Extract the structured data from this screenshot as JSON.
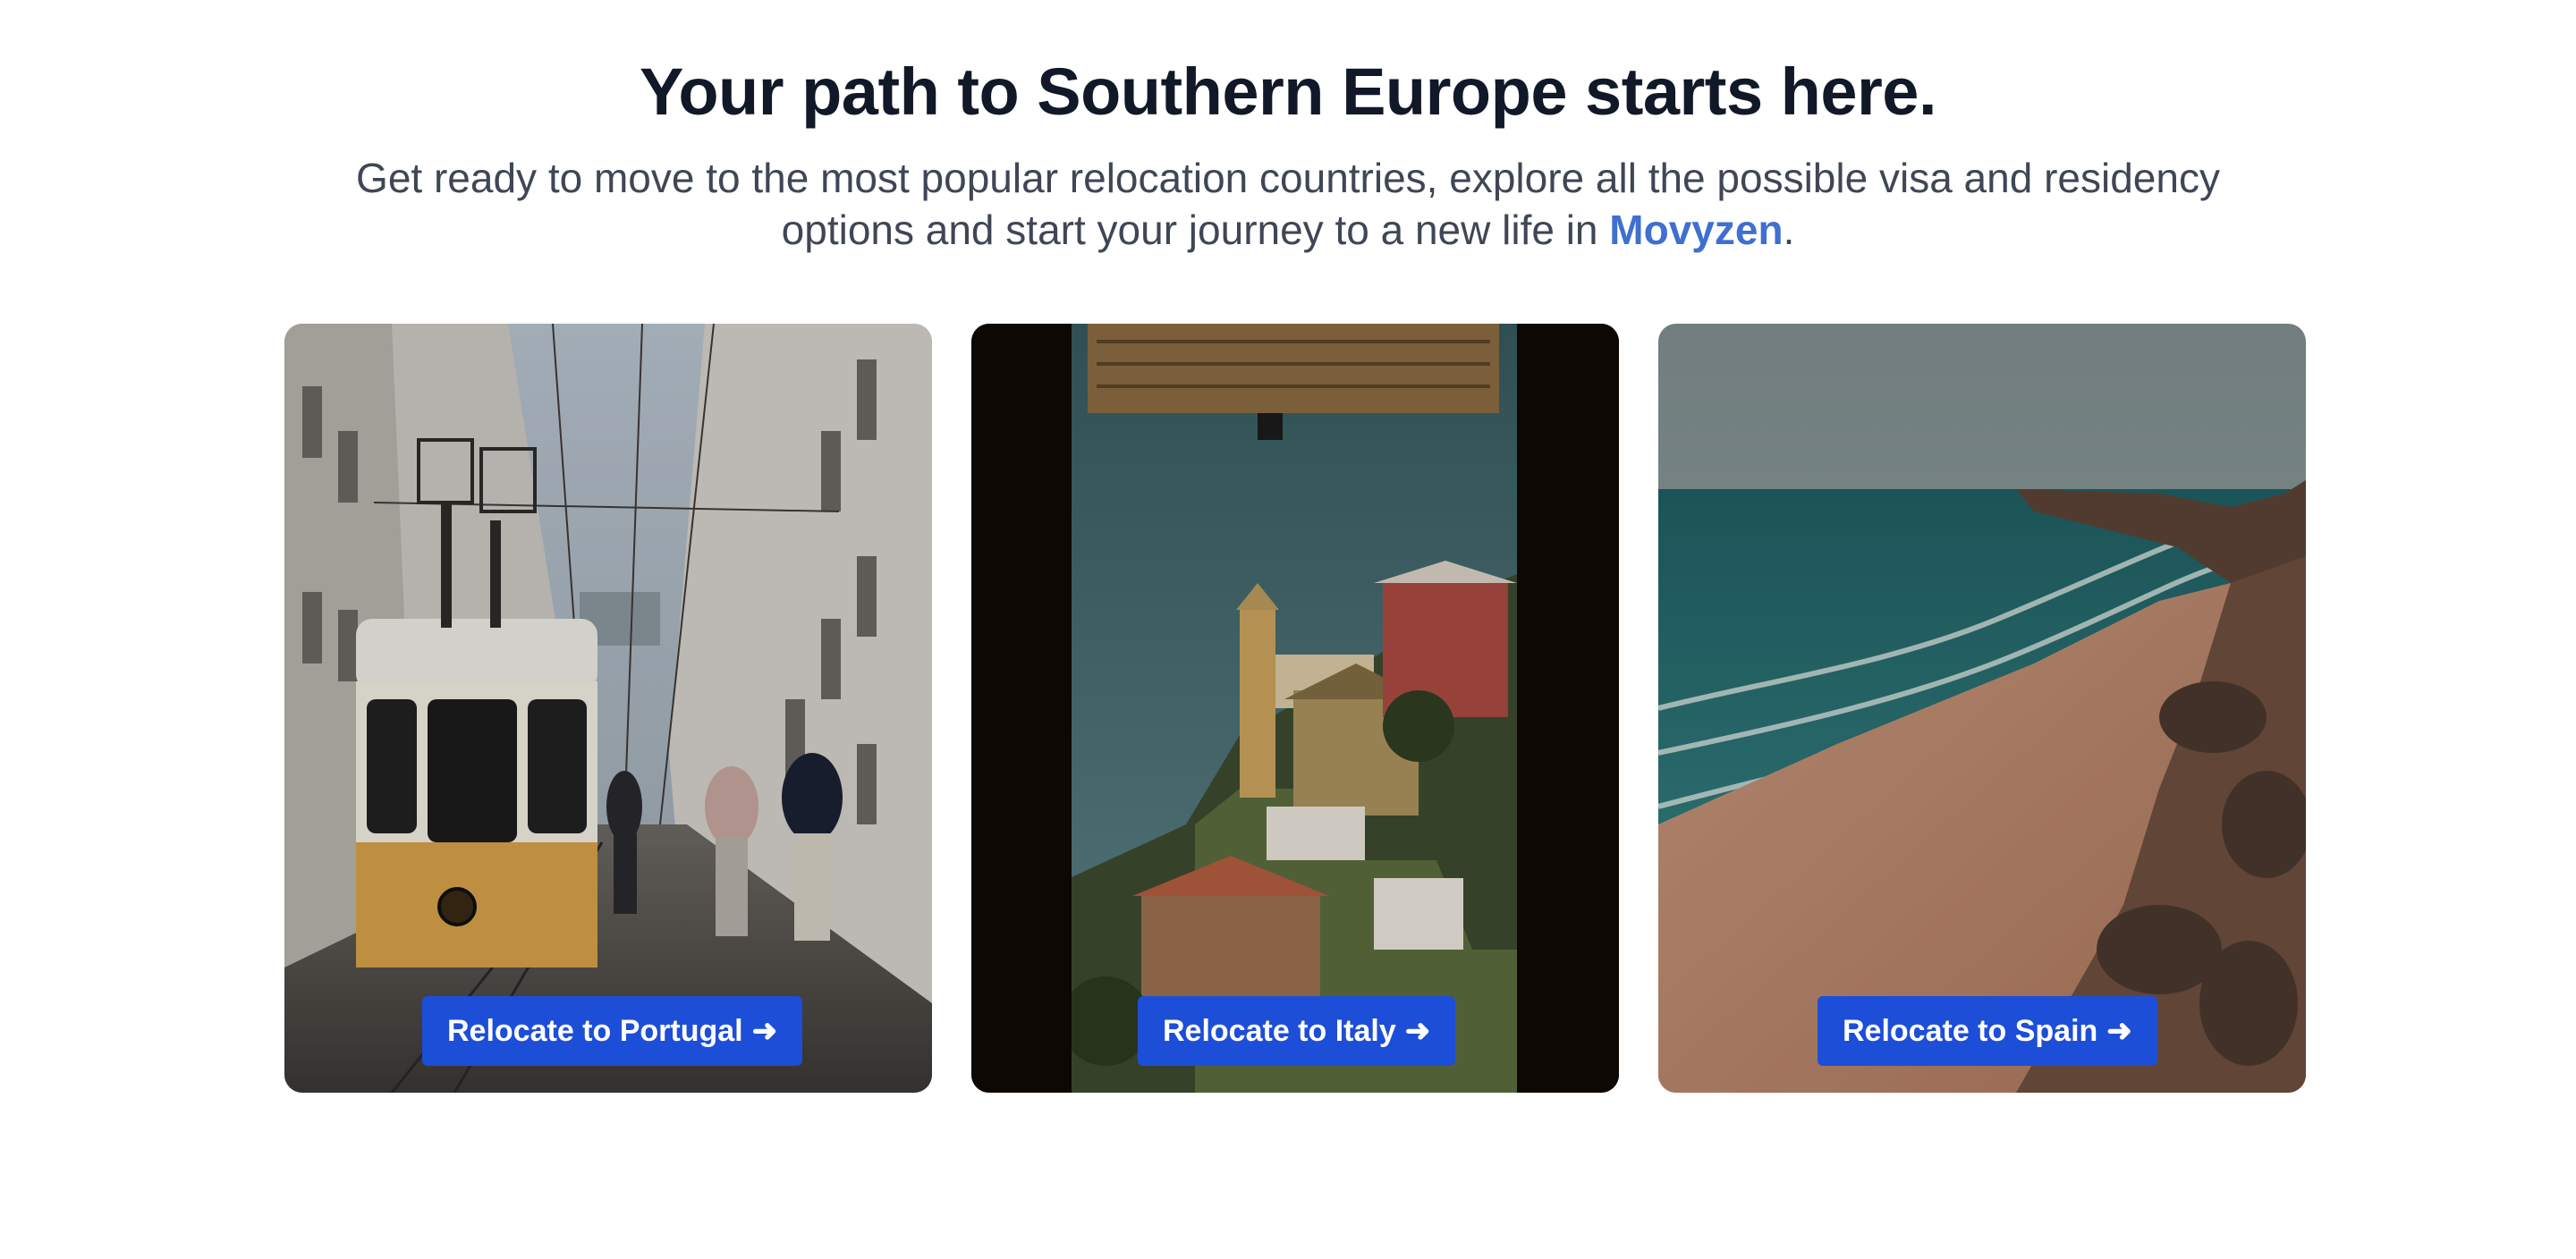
{
  "hero": {
    "title": "Your path to Southern Europe starts here.",
    "subtitle_before": "Get ready to move to the most popular relocation countries, explore all the possible visa and residency options and start your journey to a new life in ",
    "brand": "Movyzen",
    "subtitle_after": "."
  },
  "cards": [
    {
      "country": "Portugal",
      "button_label": "Relocate to Portugal",
      "arrow": "➜"
    },
    {
      "country": "Italy",
      "button_label": "Relocate to Italy",
      "arrow": "➜"
    },
    {
      "country": "Spain",
      "button_label": "Relocate to Spain",
      "arrow": "➜"
    }
  ],
  "colors": {
    "button": "#1d4ed8",
    "brand": "#3f6fd0",
    "title": "#111827"
  }
}
